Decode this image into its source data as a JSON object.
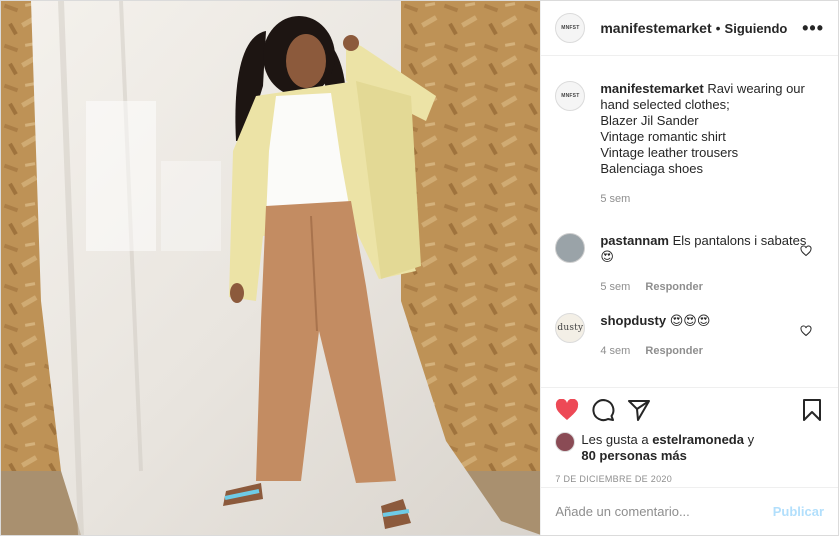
{
  "header": {
    "avatar_text": "MNFST",
    "username": "manifestemarket",
    "separator": "•",
    "follow_status": "Siguiendo",
    "more": "•••"
  },
  "caption": {
    "avatar_text": "MNFST",
    "username": "manifestemarket",
    "lines": [
      "Ravi wearing our hand selected clothes;",
      "Blazer Jil Sander",
      "Vintage romantic shirt",
      "Vintage leather trousers",
      "Balenciaga shoes"
    ],
    "time": "5 sem"
  },
  "comments": [
    {
      "username": "pastannam",
      "text": "Els pantalons i sabates 😍",
      "time": "5 sem",
      "reply": "Responder"
    },
    {
      "username": "shopdusty",
      "avatar_text": "dusty",
      "text": "😍😍😍",
      "time": "4 sem",
      "reply": "Responder"
    }
  ],
  "likes": {
    "prefix": "Les gusta a",
    "user": "estelramoneda",
    "suffix": "y",
    "others": "80 personas más"
  },
  "date": "7 DE DICIEMBRE DE 2020",
  "add_comment": {
    "placeholder": "Añade un comentario...",
    "post_label": "Publicar"
  },
  "colors": {
    "like_red": "#ed4956",
    "post_button_disabled": "#b2dffc",
    "muted_text": "#8e8e8e"
  }
}
